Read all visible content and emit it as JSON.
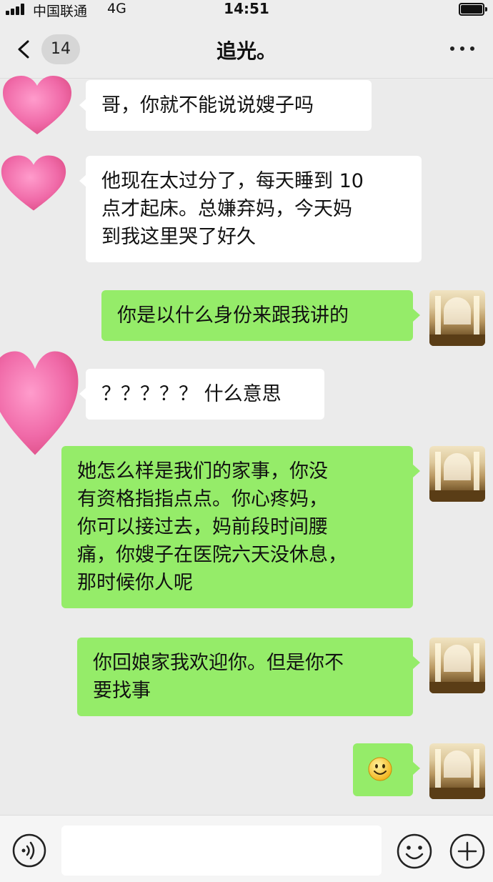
{
  "status_bar": {
    "carrier": "中国联通",
    "network": "4G",
    "time": "14:51"
  },
  "nav": {
    "unread_count": "14",
    "title": "追光。"
  },
  "colors": {
    "outgoing_bubble": "#95ec69",
    "incoming_bubble": "#ffffff",
    "chat_background": "#ebebeb",
    "heart_avatar": "#f06aa8"
  },
  "messages": [
    {
      "from": "other",
      "avatar": "pink-heart",
      "text": "哥，你就不能说说嫂子吗"
    },
    {
      "from": "other",
      "avatar": "pink-heart",
      "text": "他现在太过分了，每天睡到 10\n点才起床。总嫌弃妈，今天妈\n到我这里哭了好久"
    },
    {
      "from": "self",
      "avatar": "palace-hall",
      "text": "你是以什么身份来跟我讲的"
    },
    {
      "from": "other",
      "avatar": "pink-heart",
      "text": "？？？？？ 什么意思"
    },
    {
      "from": "self",
      "avatar": "palace-hall",
      "text": "她怎么样是我们的家事，你没\n有资格指指点点。你心疼妈，\n你可以接过去，妈前段时间腰\n痛，你嫂子在医院六天没休息，\n那时候你人呢"
    },
    {
      "from": "self",
      "avatar": "palace-hall",
      "text": "你回娘家我欢迎你。但是你不\n要找事"
    },
    {
      "from": "self",
      "avatar": "palace-hall",
      "emoji": "smiley-face"
    }
  ],
  "input_bar": {
    "placeholder": "",
    "icons": [
      "voice-icon",
      "emoji-icon",
      "plus-icon"
    ]
  }
}
